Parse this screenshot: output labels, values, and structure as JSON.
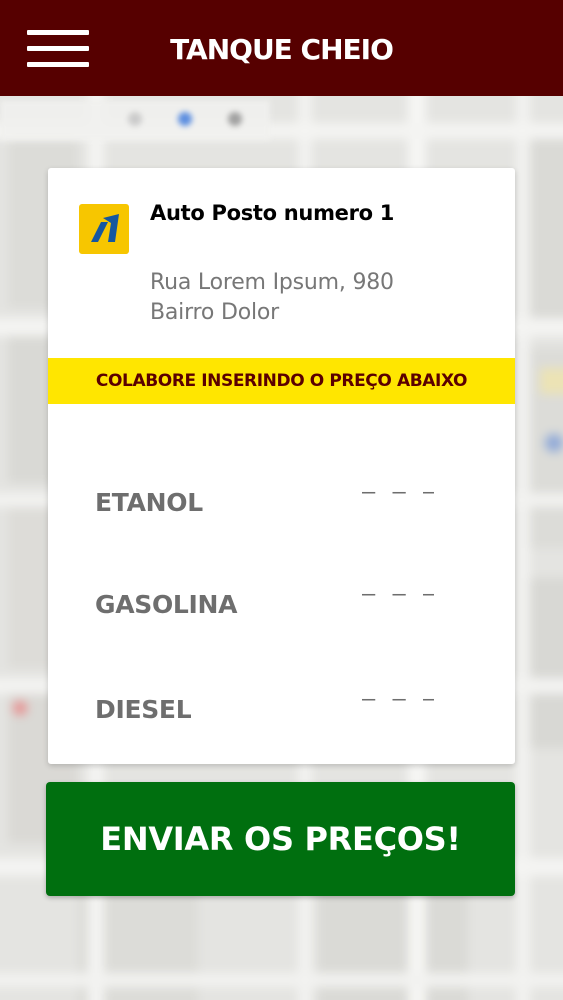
{
  "app": {
    "title": "TANQUE CHEIO"
  },
  "header": {
    "menu_icon": "hamburger-menu-icon"
  },
  "station": {
    "name": "Auto Posto numero 1",
    "address_line1": "Rua Lorem Ipsum, 980",
    "address_line2": "Bairro Dolor",
    "logo_icon": "ipiranga-brand-logo"
  },
  "banner": {
    "text": "COLABORE INSERINDO O PREÇO ABAIXO"
  },
  "fuels": [
    {
      "label": "ETANOL",
      "price_placeholder": "– – –"
    },
    {
      "label": "GASOLINA",
      "price_placeholder": "– – –"
    },
    {
      "label": "DIESEL",
      "price_placeholder": "– – –"
    }
  ],
  "submit": {
    "label": "ENVIAR OS PREÇOS!"
  },
  "colors": {
    "header_bg": "#560000",
    "banner_bg": "#ffe600",
    "banner_text": "#5a0000",
    "submit_bg": "#006f0f",
    "logo_bg": "#f7c600",
    "logo_mark": "#1557a0",
    "label_gray": "#6e6e6e"
  }
}
